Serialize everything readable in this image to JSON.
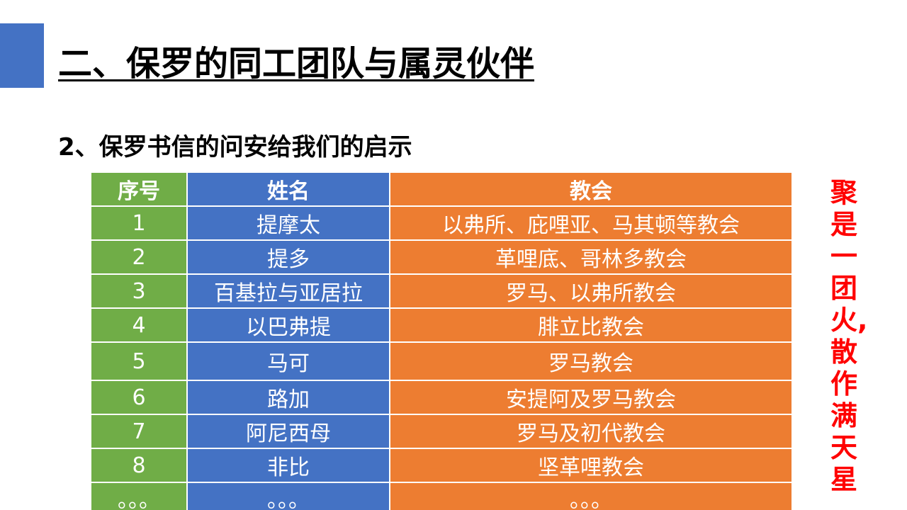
{
  "slide": {
    "title": "二、保罗的同工团队与属灵伙伴",
    "subtitle": "2、保罗书信的问安给我们的启示"
  },
  "table": {
    "headers": [
      "序号",
      "姓名",
      "教会"
    ],
    "rows": [
      [
        "1",
        "提摩太",
        "以弗所、庇哩亚、马其顿等教会"
      ],
      [
        "2",
        "提多",
        "革哩底、哥林多教会"
      ],
      [
        "3",
        "百基拉与亚居拉",
        "罗马、以弗所教会"
      ],
      [
        "4",
        "以巴弗提",
        "腓立比教会"
      ],
      [
        "5",
        "马可",
        "罗马教会"
      ],
      [
        "6",
        "路加",
        "安提阿及罗马教会"
      ],
      [
        "7",
        "阿尼西母",
        "罗马及初代教会"
      ],
      [
        "8",
        "非比",
        "坚革哩教会"
      ]
    ],
    "ellipsis_row": [
      "。。。",
      "。。。",
      "。。。"
    ]
  },
  "side_note": [
    "聚",
    "是",
    "一",
    "团",
    "火,",
    "散",
    "作",
    "满",
    "天",
    "星"
  ],
  "colors": {
    "accent_bar": "#4472c4",
    "col_number": "#70ad47",
    "col_name": "#4472c4",
    "col_church": "#ed7d31",
    "side_note": "#ff0000"
  }
}
